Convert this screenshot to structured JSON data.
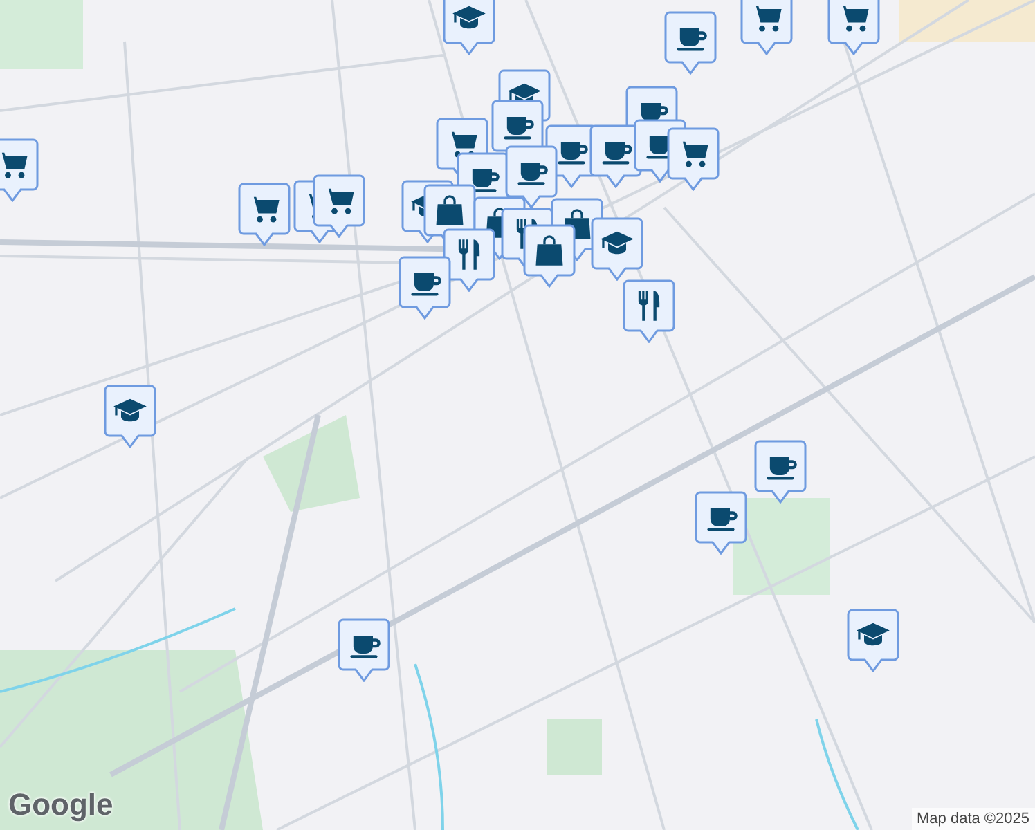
{
  "map": {
    "attribution": "Map data ©2025",
    "logo": "Google",
    "markers": [
      {
        "kind": "school"
      },
      {
        "kind": "coffee"
      },
      {
        "kind": "cart"
      },
      {
        "kind": "cart"
      },
      {
        "kind": "cart"
      },
      {
        "kind": "school"
      },
      {
        "kind": "coffee"
      },
      {
        "kind": "cart"
      },
      {
        "kind": "coffee"
      },
      {
        "kind": "coffee"
      },
      {
        "kind": "coffee"
      },
      {
        "kind": "coffee"
      },
      {
        "kind": "cart"
      },
      {
        "kind": "coffee"
      },
      {
        "kind": "coffee"
      },
      {
        "kind": "cart"
      },
      {
        "kind": "cart"
      },
      {
        "kind": "cart"
      },
      {
        "kind": "school"
      },
      {
        "kind": "bag"
      },
      {
        "kind": "bag"
      },
      {
        "kind": "restaurant"
      },
      {
        "kind": "restaurant"
      },
      {
        "kind": "bag"
      },
      {
        "kind": "bag"
      },
      {
        "kind": "school"
      },
      {
        "kind": "restaurant"
      },
      {
        "kind": "coffee"
      },
      {
        "kind": "school"
      },
      {
        "kind": "coffee"
      },
      {
        "kind": "coffee"
      },
      {
        "kind": "school"
      },
      {
        "kind": "coffee"
      }
    ]
  }
}
